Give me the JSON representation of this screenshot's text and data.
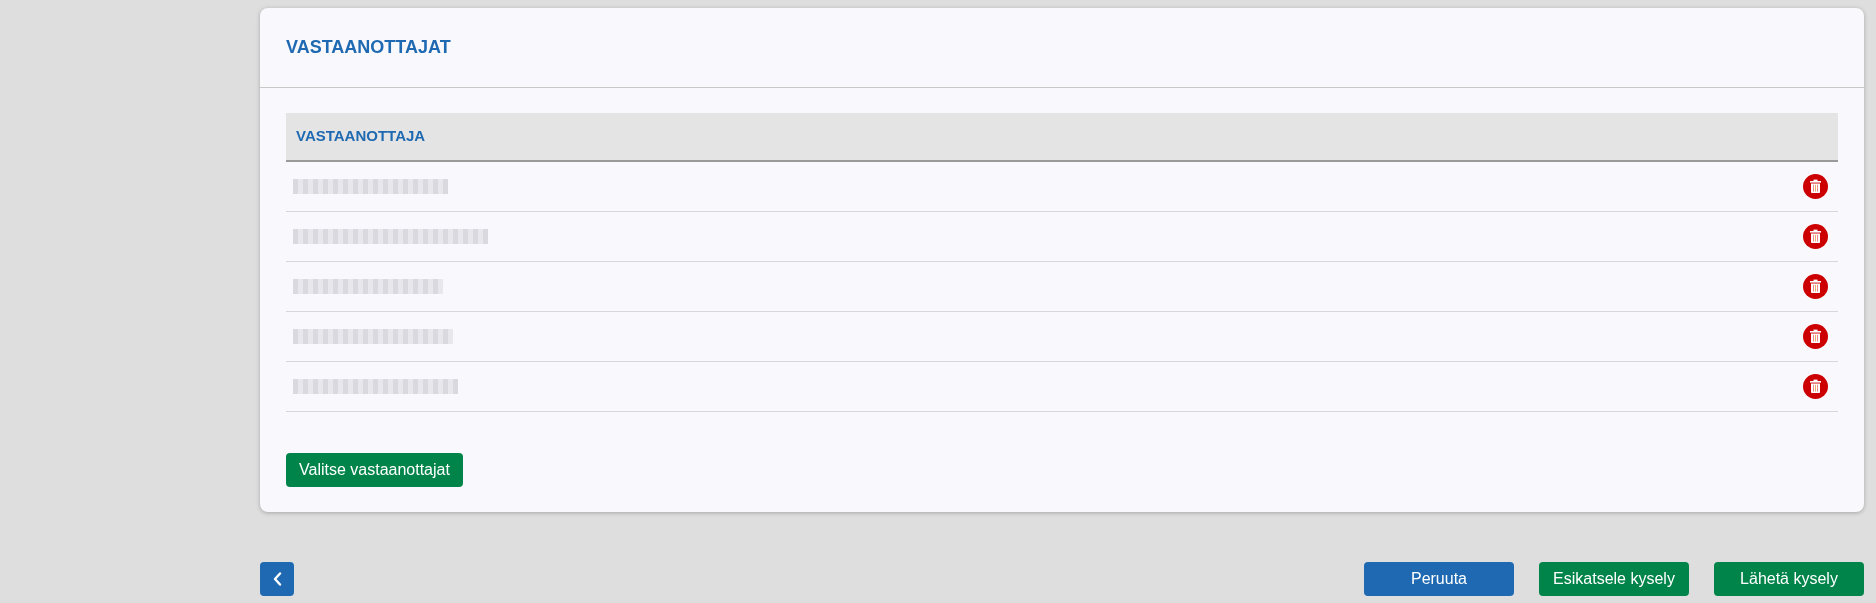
{
  "section": {
    "title": "VASTAANOTTAJAT"
  },
  "table": {
    "columns": [
      "VASTAANOTTAJA"
    ],
    "rows": [
      {
        "kind": "redacted"
      },
      {
        "kind": "redacted"
      },
      {
        "kind": "redacted"
      },
      {
        "kind": "redacted"
      },
      {
        "kind": "redacted"
      }
    ]
  },
  "select_button": {
    "label": "Valitse vastaanottajat"
  },
  "actions": [
    {
      "label": "Peruuta",
      "kind": "secondary"
    },
    {
      "label": "Esikatsele kysely",
      "kind": "primary"
    },
    {
      "label": "Lähetä kysely",
      "kind": "primary"
    }
  ]
}
